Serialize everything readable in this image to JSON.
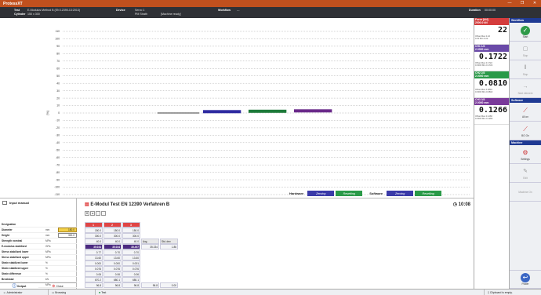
{
  "window": {
    "title": "ProtessXT",
    "controls": [
      "—",
      "❐",
      "✕"
    ]
  },
  "info": {
    "test_label": "Test",
    "test_value": "E-Modulus Method B (EN 12390-13:2013)",
    "cylinder_label": "Cylinder",
    "cylinder_value": "150 x 300",
    "device_label": "Device",
    "device_value": "Servo 1",
    "pm_value": "PM Strath",
    "machine_state": "[Machine ready]",
    "workflow_label": "Workflow",
    "workflow_value": "---",
    "duration_label": "Duration",
    "duration_value": "00:00:00"
  },
  "chart_data": {
    "type": "line",
    "ylabel": "[%]",
    "y_ticks": [
      "110",
      "100",
      "90",
      "80",
      "70",
      "60",
      "50",
      "40",
      "30",
      "20",
      "10",
      "0",
      "-10",
      "-20",
      "-30",
      "-40",
      "-50",
      "-60",
      "-70",
      "-80",
      "-90",
      "-100",
      "-110"
    ],
    "ylim": [
      -110,
      110
    ],
    "grid": true,
    "series": [
      {
        "color": "#111111",
        "xrange": [
          0.25,
          0.36
        ],
        "y": 0
      },
      {
        "color": "#2d2aa0",
        "xrange": [
          0.37,
          0.47
        ],
        "y": 0
      },
      {
        "color": "#1d7a3a",
        "xrange": [
          0.49,
          0.59
        ],
        "y": 0
      },
      {
        "color": "#6a2a8a",
        "xrange": [
          0.61,
          0.71
        ],
        "y": 0
      }
    ]
  },
  "channels": [
    {
      "head_line1": "Force [kN]",
      "head_line2": "2000.0 kN",
      "head_color": "#d43c3c",
      "value": "22",
      "offset_label": "Offset",
      "offset_value": "0.00",
      "max_label": "Max",
      "max_value": "0.22",
      "min_label": "Min",
      "min_value": "0.22"
    },
    {
      "head_line1": "CH1 1/3",
      "head_line2": "2.0000 mm",
      "head_color": "#6a4aa8",
      "value": "0.1722",
      "offset_label": "Offset",
      "offset_value": "0.0000",
      "max_label": "Max",
      "max_value": "0.1722",
      "min_label": "Min",
      "min_value": "0.1722"
    },
    {
      "head_line1": "CH2 2/3",
      "head_line2": "2.0000 mm",
      "head_color": "#2a9a48",
      "value": "0.0810",
      "offset_label": "Offset",
      "offset_value": "0.0000",
      "max_label": "Max",
      "max_value": "0.0810",
      "min_label": "Min",
      "min_value": "0.0810"
    },
    {
      "head_line1": "CH3 3/3",
      "head_line2": "2.0000 mm",
      "head_color": "#7a3a9a",
      "value": "0.1266",
      "offset_label": "Offset",
      "offset_value": "0.0000",
      "max_label": "Max",
      "max_value": "0.1266",
      "min_label": "Min",
      "min_value": "0.1266"
    }
  ],
  "workflow_panel": {
    "head": "Workflow",
    "start": "Start",
    "stop": "Stop",
    "pause": "Stop",
    "next": "Next element",
    "software_head": "Software",
    "zero_all": "All on",
    "zero_on": "BO On",
    "machine_head": "Machine",
    "settings": "Settings",
    "edit": "Edit",
    "machine_on": "Machine On",
    "power": "Power"
  },
  "buttons_bar": {
    "hardware": "Hardware",
    "software": "Software",
    "zeroing": "Zeroing",
    "resetting": "Resetting"
  },
  "input_panel": {
    "title": "Input manual",
    "rows": [
      {
        "name": "Designation",
        "unit": "",
        "value": ""
      },
      {
        "name": "Diameter",
        "unit": "mm",
        "value": "150.0"
      },
      {
        "name": "Height",
        "unit": "mm",
        "value": "300.0"
      },
      {
        "name": "Strength nominal",
        "unit": "MPa",
        "value": ""
      },
      {
        "name": "E-modulus stabilized",
        "unit": "GPa",
        "value": ""
      },
      {
        "name": "Stress stabilized lower",
        "unit": "MPa",
        "value": ""
      },
      {
        "name": "Stress stabilized upper",
        "unit": "MPa",
        "value": ""
      },
      {
        "name": "Strain stabilized lower",
        "unit": "%",
        "value": ""
      },
      {
        "name": "Strain stabilized upper",
        "unit": "%",
        "value": ""
      },
      {
        "name": "Strain difference",
        "unit": "%",
        "value": ""
      },
      {
        "name": "Breakload",
        "unit": "kN",
        "value": ""
      },
      {
        "name": "Strength",
        "unit": "MPa",
        "value": ""
      }
    ],
    "tab_output": "Output",
    "tab_close": "Close"
  },
  "table": {
    "title": "E-Modul Test EN 12390 Verfahren B",
    "time": "10:08",
    "nav": [
      "H",
      "◂"
    ],
    "col_headers": [
      "1",
      "2",
      "3"
    ],
    "extra_headers": [
      "Avg.",
      "Std. dev"
    ],
    "rows": [
      [
        "150.0",
        "150.0",
        "150.0"
      ],
      [
        "300.0",
        "300.0",
        "300.0"
      ],
      [
        "40.0",
        "40.0",
        "40.0"
      ],
      [
        "35.034",
        "35.034",
        "35.497"
      ],
      [
        "0.77",
        "0.70",
        "0.70"
      ],
      [
        "13.60",
        "13.60",
        "13.60"
      ],
      [
        "0.000",
        "0.000",
        "0.001"
      ],
      [
        "0.076",
        "0.076",
        "0.076"
      ],
      [
        "0.06",
        "0.06",
        "0.06"
      ],
      [
        "670.2",
        "680.1",
        "680.1"
      ],
      [
        "96.8",
        "96.8",
        "96.8"
      ]
    ],
    "avg_row3": "35.334",
    "std_row3": "1.86",
    "avg_row10": "96.8",
    "std_row10": "0.00"
  },
  "status": {
    "user": "Administrator",
    "mode": "Browsing",
    "test": "Test",
    "clipboard": "Clipboard is empty."
  }
}
